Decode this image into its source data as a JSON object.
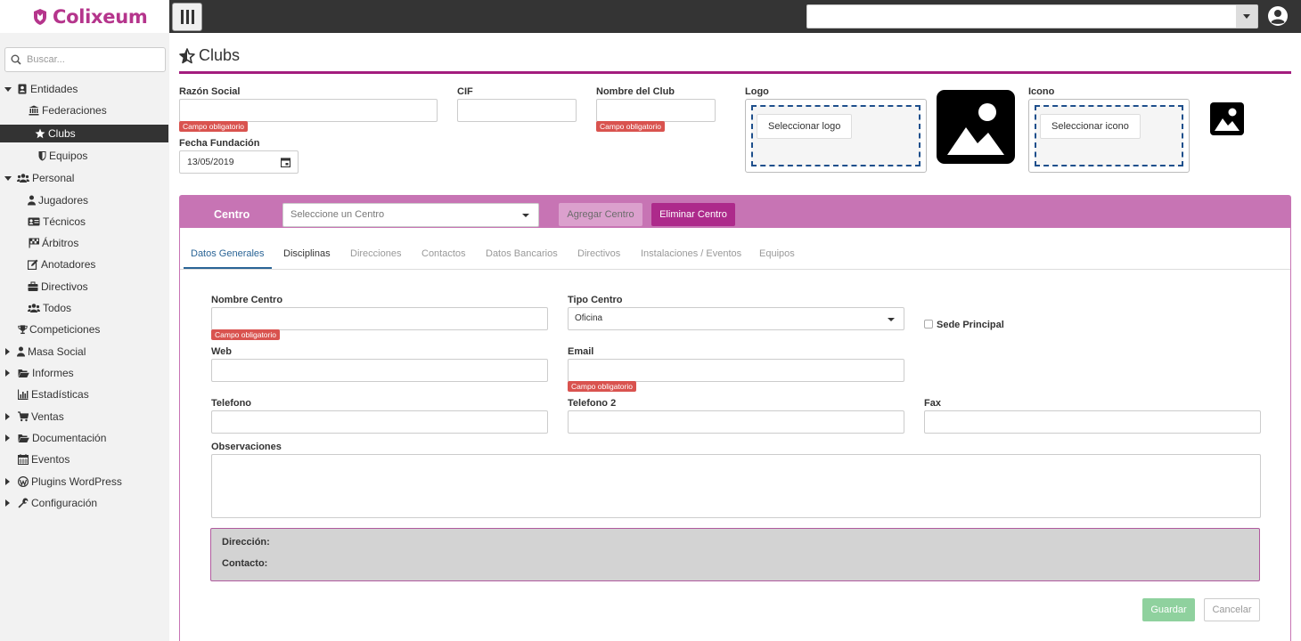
{
  "brand": {
    "name": "Colixeum"
  },
  "header": {
    "user_icon": "user-circle-icon"
  },
  "sidebar": {
    "search_placeholder": "Buscar...",
    "items": [
      {
        "label": "Entidades",
        "icon": "address-book-icon"
      },
      {
        "label": "Federaciones",
        "icon": "bank-icon"
      },
      {
        "label": "Clubs",
        "icon": "star-half-icon"
      },
      {
        "label": "Equipos",
        "icon": "shield-icon"
      },
      {
        "label": "Personal",
        "icon": "users-icon"
      },
      {
        "label": "Jugadores",
        "icon": "user-icon"
      },
      {
        "label": "Técnicos",
        "icon": "id-card-icon"
      },
      {
        "label": "Árbitros",
        "icon": "flag-checkered-icon"
      },
      {
        "label": "Anotadores",
        "icon": "edit-icon"
      },
      {
        "label": "Directivos",
        "icon": "briefcase-icon"
      },
      {
        "label": "Todos",
        "icon": "users-icon"
      },
      {
        "label": "Competiciones",
        "icon": "trophy-icon"
      },
      {
        "label": "Masa Social",
        "icon": "user-icon"
      },
      {
        "label": "Informes",
        "icon": "folder-open-icon"
      },
      {
        "label": "Estadísticas",
        "icon": "bar-chart-icon"
      },
      {
        "label": "Ventas",
        "icon": "shopping-cart-icon"
      },
      {
        "label": "Documentación",
        "icon": "folder-open-icon"
      },
      {
        "label": "Eventos",
        "icon": "calendar-icon"
      },
      {
        "label": "Plugins WordPress",
        "icon": "wordpress-icon"
      },
      {
        "label": "Configuración",
        "icon": "wrench-icon"
      }
    ]
  },
  "page": {
    "title": "Clubs",
    "razon_social_label": "Razón Social",
    "cif_label": "CIF",
    "nombre_club_label": "Nombre del Club",
    "logo_label": "Logo",
    "icono_label": "Icono",
    "fecha_fundacion_label": "Fecha Fundación",
    "fecha_fundacion_value": "13/05/2019",
    "required_text": "Campo obligatorio",
    "select_logo": "Seleccionar logo",
    "select_icon": "Seleccionar icono"
  },
  "centro": {
    "label": "Centro",
    "select_placeholder": "Seleccione un Centro",
    "add_button": "Agregar Centro",
    "delete_button": "Eliminar Centro",
    "tabs": [
      "Datos Generales",
      "Disciplinas",
      "Direcciones",
      "Contactos",
      "Datos Bancarios",
      "Directivos",
      "Instalaciones / Eventos",
      "Equipos"
    ],
    "form": {
      "nombre_centro": "Nombre Centro",
      "tipo_centro": "Tipo Centro",
      "tipo_centro_value": "Oficina",
      "sede_principal": "Sede Principal",
      "web": "Web",
      "email": "Email",
      "telefono": "Telefono",
      "telefono2": "Telefono 2",
      "fax": "Fax",
      "observaciones": "Observaciones",
      "direccion": "Dirección:",
      "contacto": "Contacto:",
      "guardar": "Guardar",
      "cancelar": "Cancelar"
    }
  },
  "colors": {
    "brand": "#b5358c",
    "accent": "#a31d7e",
    "panel": "#c774b4",
    "required": "#d9534f"
  }
}
